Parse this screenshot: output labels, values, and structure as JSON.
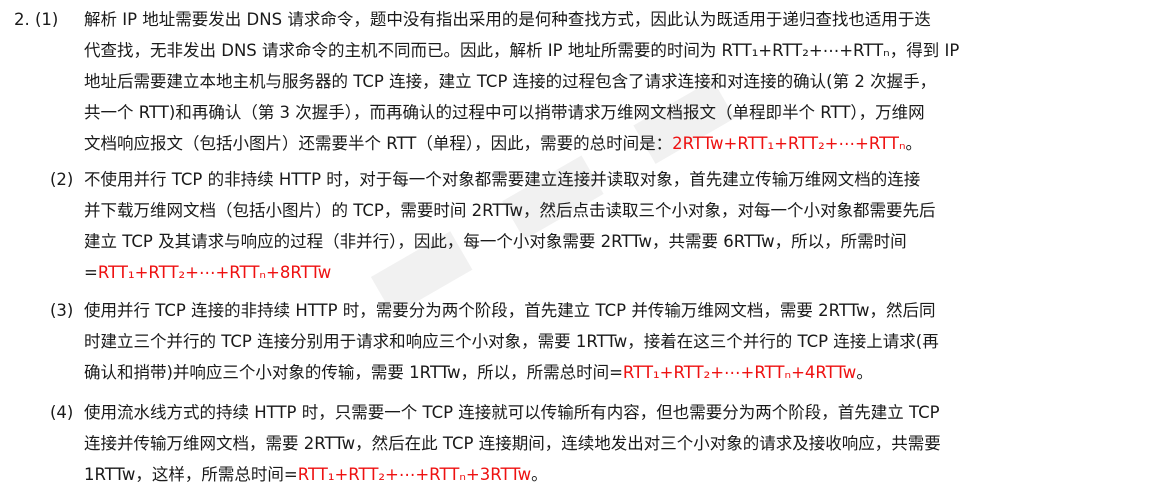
{
  "p1": {
    "num": "2. (1)",
    "lines": [
      "解析 IP 地址需要发出 DNS 请求命令，题中没有指出采用的是何种查找方式，因此认为既适用于递归查找也适用于迭",
      "代查找，无非发出 DNS 请求命令的主机不同而已。因此，解析 IP 地址所需要的时间为 RTT₁+RTT₂+⋯+RTTₙ，得到 IP",
      "地址后需要建立本地主机与服务器的 TCP 连接，建立 TCP 连接的过程包含了请求连接和对连接的确认(第 2 次握手，",
      "共一个 RTT)和再确认（第 3 次握手），而再确认的过程中可以捎带请求万维网文档报文（单程即半个 RTT），万维网"
    ],
    "last_plain": "文档响应报文（包括小图片）还需要半个 RTT（单程），因此，需要的总时间是：",
    "last_red": "2RTTw+RTT₁+RTT₂+⋯+RTTₙ",
    "last_end": "。"
  },
  "p2": {
    "num": "(2)",
    "lines": [
      "不使用并行 TCP 的非持续 HTTP 时，对于每一个对象都需要建立连接并读取对象，首先建立传输万维网文档的连接",
      "并下载万维网文档（包括小图片）的 TCP，需要时间 2RTTw，然后点击读取三个小对象，对每一个小对象都需要先后",
      "建立 TCP 及其请求与响应的过程（非并行），因此，每一个小对象需要 2RTTw，共需要 6RTTw，所以，所需时间"
    ],
    "last_plain": "=",
    "last_red": "RTT₁+RTT₂+⋯+RTTₙ+8RTTw",
    "last_end": ""
  },
  "p3": {
    "num": "(3)",
    "lines": [
      "使用并行 TCP 连接的非持续 HTTP 时，需要分为两个阶段，首先建立 TCP 并传输万维网文档，需要 2RTTw，然后同",
      "时建立三个并行的 TCP 连接分别用于请求和响应三个小对象，需要 1RTTw，接着在这三个并行的 TCP 连接上请求(再"
    ],
    "last_plain": "确认和捎带)并响应三个小对象的传输，需要 1RTTw，所以，所需总时间=",
    "last_red": "RTT₁+RTT₂+⋯+RTTₙ+4RTTw",
    "last_end": "。"
  },
  "p4": {
    "num": "(4)",
    "lines": [
      "使用流水线方式的持续 HTTP 时，只需要一个 TCP 连接就可以传输所有内容，但也需要分为两个阶段，首先建立 TCP",
      "连接并传输万维网文档，需要 2RTTw，然后在此 TCP 连接期间，连续地发出对三个小对象的请求及接收响应，共需要"
    ],
    "last_plain": "1RTTw，这样，所需总时间=",
    "last_red": "RTT₁+RTT₂+⋯+RTTₙ+3RTTw",
    "last_end": "。"
  }
}
